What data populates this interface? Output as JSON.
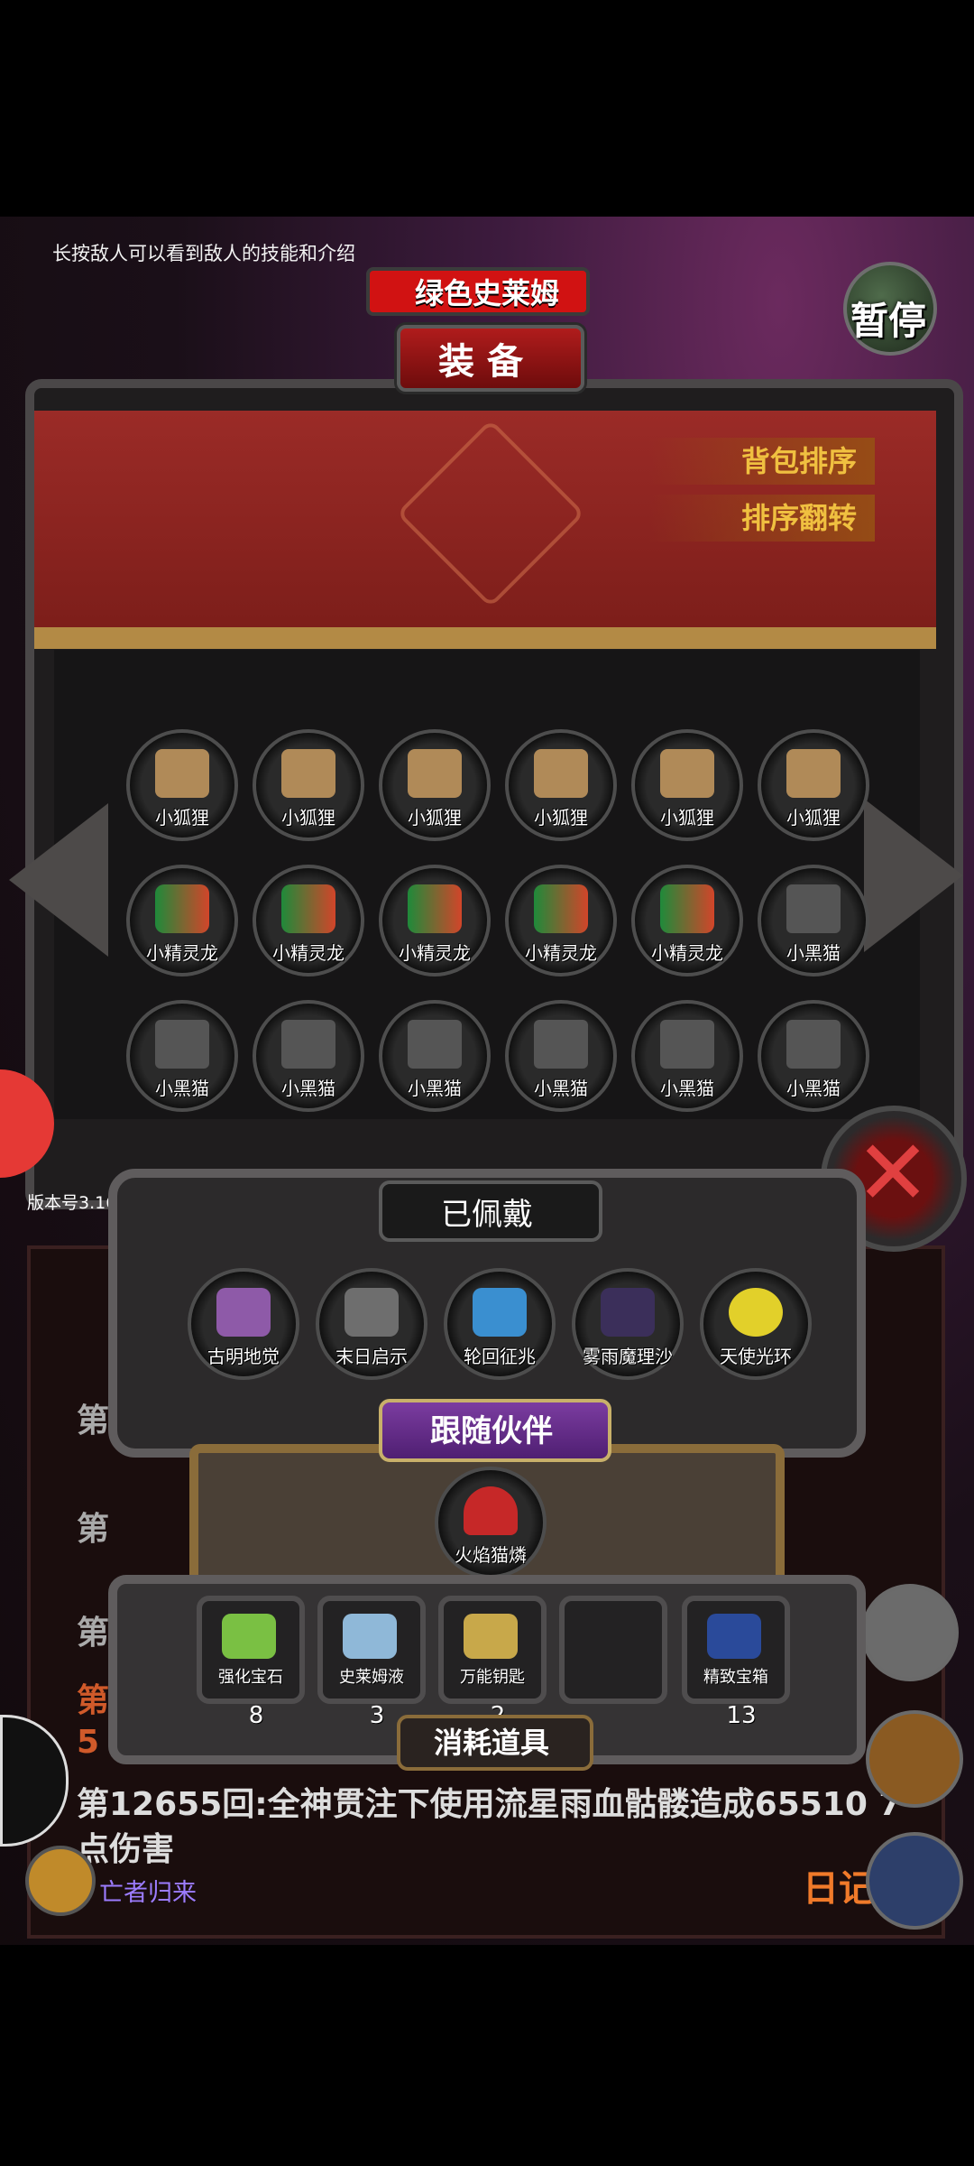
{
  "hint_text": "长按敌人可以看到敌人的技能和介绍",
  "enemy_name": "绿色史莱姆",
  "panel_title": "装备",
  "pause_label": "暂停",
  "sort_buttons": {
    "sort": "背包排序",
    "flip": "排序翻转"
  },
  "inventory": [
    [
      "小狐狸",
      "小狐狸",
      "小狐狸",
      "小狐狸",
      "小狐狸",
      "小狐狸"
    ],
    [
      "小精灵龙",
      "小精灵龙",
      "小精灵龙",
      "小精灵龙",
      "小精灵龙",
      "小黑猫"
    ],
    [
      "小黑猫",
      "小黑猫",
      "小黑猫",
      "小黑猫",
      "小黑猫",
      "小黑猫"
    ]
  ],
  "version_label": "版本号3.16",
  "equipped": {
    "title": "已佩戴",
    "items": [
      "古明地觉",
      "末日启示",
      "轮回征兆",
      "雾雨魔理沙",
      "天使光环"
    ]
  },
  "companion": {
    "title": "跟随伙伴",
    "name": "火焰猫燐"
  },
  "consumables": {
    "title": "消耗道具",
    "items": [
      {
        "name": "强化宝石",
        "count": "8"
      },
      {
        "name": "史莱姆液",
        "count": "3"
      },
      {
        "name": "万能钥匙",
        "count": "2"
      },
      {
        "name": "",
        "count": ""
      },
      {
        "name": "精致宝箱",
        "count": "13"
      }
    ]
  },
  "log": {
    "partial_lines": [
      "第",
      "第",
      "第",
      "第",
      "5"
    ],
    "main_line": "第12655回:全神贯注下使用流星雨血骷髅造成65510 7点伤害",
    "dead_return": "亡者归来",
    "diary": "日记"
  },
  "colors": {
    "accent_gold": "#f0c040",
    "close_red": "#e04040",
    "curtain_red": "#9b2b27"
  }
}
